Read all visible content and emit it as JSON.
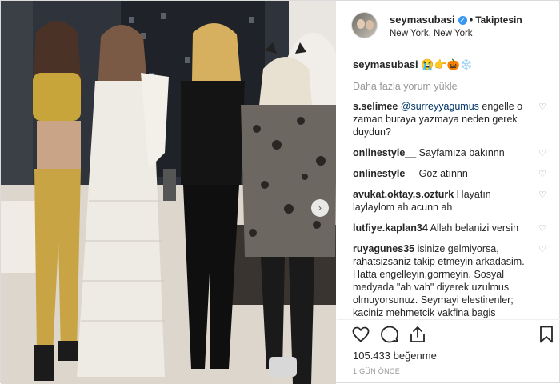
{
  "post": {
    "username": "seymasubasi",
    "verified_mark": "✓",
    "separator": "•",
    "follow_status": "Takiptesin",
    "location": "New York, New York"
  },
  "caption": {
    "username": "seymasubasi",
    "text": "😭👉🎃❄️"
  },
  "load_more": "Daha fazla yorum yükle",
  "comments": [
    {
      "user": "s.selimee",
      "mention": "@surreyyagumus",
      "text": " engelle o zaman buraya yazmaya neden gerek duydun?",
      "liked_icon": "♡"
    },
    {
      "user": "onlinestyle__",
      "mention": "",
      "text": " Sayfamıza bakınnn",
      "liked_icon": "♡"
    },
    {
      "user": "onlinestyle__",
      "mention": "",
      "text": " Göz atınnn",
      "liked_icon": "♡"
    },
    {
      "user": "avukat.oktay.s.ozturk",
      "mention": "",
      "text": " Hayatın laylaylom ah acunn ah",
      "liked_icon": "♡"
    },
    {
      "user": "lutfiye.kaplan34",
      "mention": "",
      "text": " Allah belanizi versin",
      "liked_icon": "♡"
    },
    {
      "user": "ruyagunes35",
      "mention": "",
      "text": " isinize gelmiyorsa, rahatsizsaniz takip etmeyin arkadasim. Hatta engelleyin,gormeyin. Sosyal medyada \"ah vah\" diyerek uzulmus olmuyorsunuz. Seymayi elestirenler; kaciniz mehmetcik vakfina bagis yaptiniz yada bos laf yapmaktan baska birsey yaptiniz? insanlari sosyal medyaya gore",
      "liked_icon": "♡"
    }
  ],
  "likes": "105.433 beğenme",
  "time_ago": "1 GÜN ÖNCE",
  "icons": {
    "like": "heart-icon",
    "comment": "comment-icon",
    "share": "share-icon",
    "save": "bookmark-icon",
    "next": "chevron-right-icon"
  },
  "next_arrow": "›",
  "colors": {
    "verified": "#3897f0",
    "mention": "#003569",
    "muted": "#999999",
    "text": "#262626"
  }
}
